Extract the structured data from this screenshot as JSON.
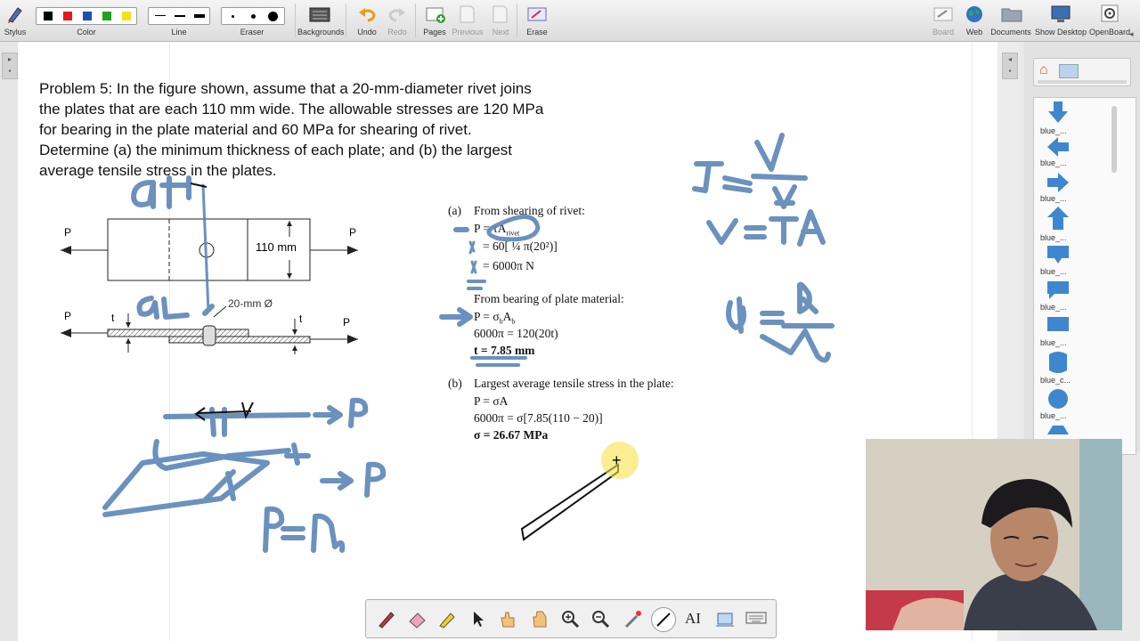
{
  "toolbar": {
    "stylus": "Stylus",
    "color": "Color",
    "line": "Line",
    "eraser": "Eraser",
    "backgrounds": "Backgrounds",
    "undo": "Undo",
    "redo": "Redo",
    "pages": "Pages",
    "previous": "Previous",
    "next": "Next",
    "erase": "Erase",
    "board": "Board",
    "web": "Web",
    "documents": "Documents",
    "show_desktop": "Show Desktop",
    "openboard": "OpenBoard",
    "colors": [
      "#000000",
      "#e11b1b",
      "#1c4fb5",
      "#1fa31f",
      "#f2e11a"
    ]
  },
  "problem": {
    "line1": "Problem 5: In the figure shown, assume that a 20-mm-diameter rivet joins",
    "line2": "the plates that are each 110 mm wide. The allowable stresses are 120 MPa",
    "line3": "for bearing in the plate material and 60 MPa for shearing of rivet.",
    "line4": "Determine (a) the minimum thickness of each plate; and (b) the largest",
    "line5": "average tensile stress in the plates."
  },
  "figure": {
    "p": "P",
    "t": "t",
    "width_label": "110 mm",
    "rivet_label": "20-mm Ø"
  },
  "solution": {
    "a_label": "(a)",
    "a_title": "From shearing of rivet:",
    "a1": "P = τA",
    "a1_sub": "rivet",
    "a2": "= 60[ ¼ π(20²)]",
    "a3": "= 6000π N",
    "bearing_title": "From bearing of plate material:",
    "b1": "P = σ",
    "b1_sub": "b",
    "b1_rest": "A",
    "b2": "6000π = 120(20t)",
    "b3": "t = 7.85 mm",
    "b_label": "(b)",
    "b_title": "Largest average tensile stress in the plate:",
    "c1": "P = σA",
    "c2": "6000π = σ[7.85(110 − 20)]",
    "c3": "σ = 26.67 MPa"
  },
  "library": {
    "items": [
      "blue_...",
      "blue_...",
      "blue_...",
      "blue_...",
      "blue_...",
      "blue_...",
      "blue_...",
      "blue_c...",
      "blue_..."
    ]
  },
  "ink_color": "#5b86b8",
  "accent_color": "#f5e34a"
}
